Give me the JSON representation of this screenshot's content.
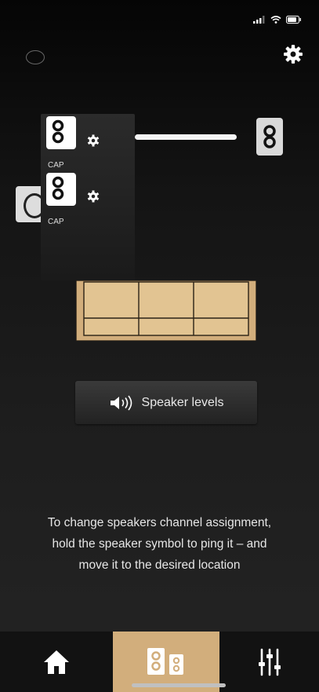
{
  "popup": {
    "items": [
      {
        "label": "CAP"
      },
      {
        "label": "CAP"
      }
    ]
  },
  "speaker_levels_button": {
    "label": "Speaker levels"
  },
  "instructions": {
    "lines": [
      "To change speakers channel assignment,",
      "hold the speaker symbol to ping it – and",
      "move it to the desired location"
    ]
  },
  "tabbar": {
    "tabs": [
      {
        "icon": "home-icon",
        "active": false
      },
      {
        "icon": "speakers-icon",
        "active": true
      },
      {
        "icon": "equalizer-sliders-icon",
        "active": false
      }
    ]
  },
  "colors": {
    "accent_tan": "#d2ae7c",
    "background": "#111111",
    "text": "#e6e6e6"
  }
}
